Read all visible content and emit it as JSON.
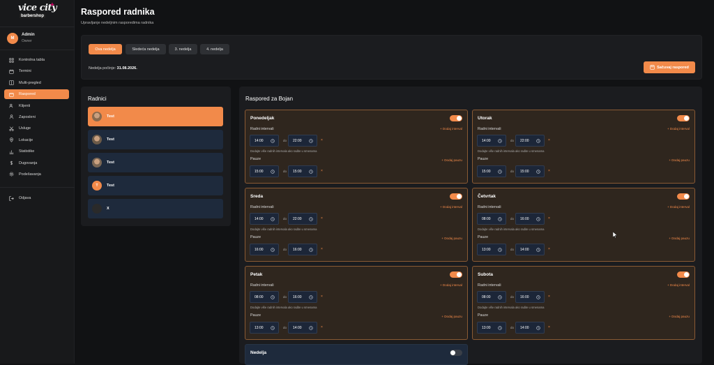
{
  "brand": {
    "line1": "vice city",
    "line2": "barbershop"
  },
  "user": {
    "initial": "M",
    "name": "Admin",
    "role": "Owner"
  },
  "nav": [
    {
      "label": "Kontrolna tabla",
      "icon": "grid-icon",
      "active": false
    },
    {
      "label": "Termini",
      "icon": "calendar-icon",
      "active": false
    },
    {
      "label": "Multi-pregled",
      "icon": "columns-icon",
      "active": false
    },
    {
      "label": "Raspored",
      "icon": "schedule-icon",
      "active": true
    },
    {
      "label": "Klijenti",
      "icon": "users-icon",
      "active": false
    },
    {
      "label": "Zaposleni",
      "icon": "staff-icon",
      "active": false
    },
    {
      "label": "Usluge",
      "icon": "scissors-icon",
      "active": false
    },
    {
      "label": "Lokacije",
      "icon": "location-icon",
      "active": false
    },
    {
      "label": "Statistike",
      "icon": "chart-icon",
      "active": false
    },
    {
      "label": "Dugovanja",
      "icon": "dollar-icon",
      "active": false
    },
    {
      "label": "Podešavanja",
      "icon": "gear-icon",
      "active": false
    }
  ],
  "logout": {
    "label": "Odjava",
    "icon": "logout-icon"
  },
  "page": {
    "title": "Raspored radnika",
    "subtitle": "Upravljanje nedeljnim rasporedima radnika"
  },
  "weeks": [
    {
      "label": "Ova nedelja",
      "active": true
    },
    {
      "label": "Sledeća nedelja",
      "active": false
    },
    {
      "label": "3. nedelja",
      "active": false
    },
    {
      "label": "4. nedelja",
      "active": false
    }
  ],
  "week_of": {
    "label": "Nedelja počinje:",
    "date": "31.08.2026."
  },
  "save_button": "Sačuvaj raspored",
  "workers_title": "Radnici",
  "workers": [
    {
      "name": "Test",
      "active": true,
      "avatar": "photo"
    },
    {
      "name": "Test",
      "active": false,
      "avatar": "photo"
    },
    {
      "name": "Test",
      "active": false,
      "avatar": "photo"
    },
    {
      "name": "Test",
      "active": false,
      "avatar": "initial",
      "initial": "T"
    },
    {
      "name": "X",
      "active": false,
      "avatar": "dark"
    }
  ],
  "schedule_title": "Raspored za Bojan",
  "labels": {
    "work_intervals": "Radni intervali",
    "add_interval": "+ Dodaj interval",
    "note": "Dodajte više radnih intervala ako radite u smenama",
    "breaks": "Pauze",
    "add_break": "+ Dodaj pauzu",
    "to": "do",
    "remove": "×"
  },
  "days": [
    {
      "name": "Ponedeljak",
      "enabled": true,
      "work": [
        "14:00",
        "22:00"
      ],
      "break": [
        "15:00",
        "15:00"
      ]
    },
    {
      "name": "Utorak",
      "enabled": true,
      "work": [
        "14:00",
        "22:00"
      ],
      "break": [
        "15:00",
        "15:00"
      ]
    },
    {
      "name": "Sreda",
      "enabled": true,
      "work": [
        "14:00",
        "22:00"
      ],
      "break": [
        "16:00",
        "16:00"
      ]
    },
    {
      "name": "Četvrtak",
      "enabled": true,
      "work": [
        "08:00",
        "16:00"
      ],
      "break": [
        "13:00",
        "14:00"
      ]
    },
    {
      "name": "Petak",
      "enabled": true,
      "work": [
        "08:00",
        "16:00"
      ],
      "break": [
        "13:00",
        "14:00"
      ]
    },
    {
      "name": "Subota",
      "enabled": true,
      "work": [
        "08:00",
        "16:00"
      ],
      "break": [
        "13:00",
        "14:00"
      ]
    },
    {
      "name": "Nedelja",
      "enabled": false
    }
  ],
  "colors": {
    "accent": "#f28a4a",
    "bg": "#111214",
    "card": "#1b1c1f",
    "day_on": "#2f261e",
    "day_off": "#1e2a3c"
  }
}
